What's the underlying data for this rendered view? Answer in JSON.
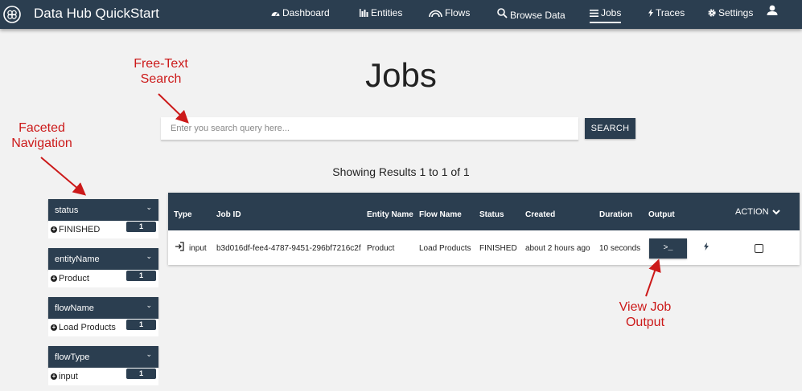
{
  "brand": "Data Hub QuickStart",
  "nav": {
    "dashboard": "Dashboard",
    "entities": "Entities",
    "flows": "Flows",
    "browse": "Browse Data",
    "jobs": "Jobs",
    "traces": "Traces",
    "settings": "Settings"
  },
  "page": {
    "title": "Jobs",
    "search_placeholder": "Enter you search query here...",
    "search_button": "SEARCH",
    "results": "Showing Results 1 to 1 of 1"
  },
  "facets": [
    {
      "name": "status",
      "value": "FINISHED",
      "count": "1"
    },
    {
      "name": "entityName",
      "value": "Product",
      "count": "1"
    },
    {
      "name": "flowName",
      "value": "Load Products",
      "count": "1"
    },
    {
      "name": "flowType",
      "value": "input",
      "count": "1"
    }
  ],
  "table": {
    "headers": {
      "type": "Type",
      "job_id": "Job ID",
      "entity": "Entity Name",
      "flow": "Flow Name",
      "status": "Status",
      "created": "Created",
      "duration": "Duration",
      "output": "Output",
      "action": "ACTION"
    },
    "rows": [
      {
        "type": "input",
        "job_id": "b3d016df-fee4-4787-9451-296bf7216c2f",
        "entity": "Product",
        "flow": "Load Products",
        "status": "FINISHED",
        "created": "about 2 hours ago",
        "duration": "10 seconds",
        "output_label": ">_"
      }
    ]
  },
  "annotations": {
    "search": "Free-Text Search",
    "facets": "Faceted Navigation",
    "output": "View Job Output"
  },
  "colors": {
    "navbar": "#2b3e50",
    "annotation": "#cc1a1a",
    "background": "#f2f2f2"
  }
}
